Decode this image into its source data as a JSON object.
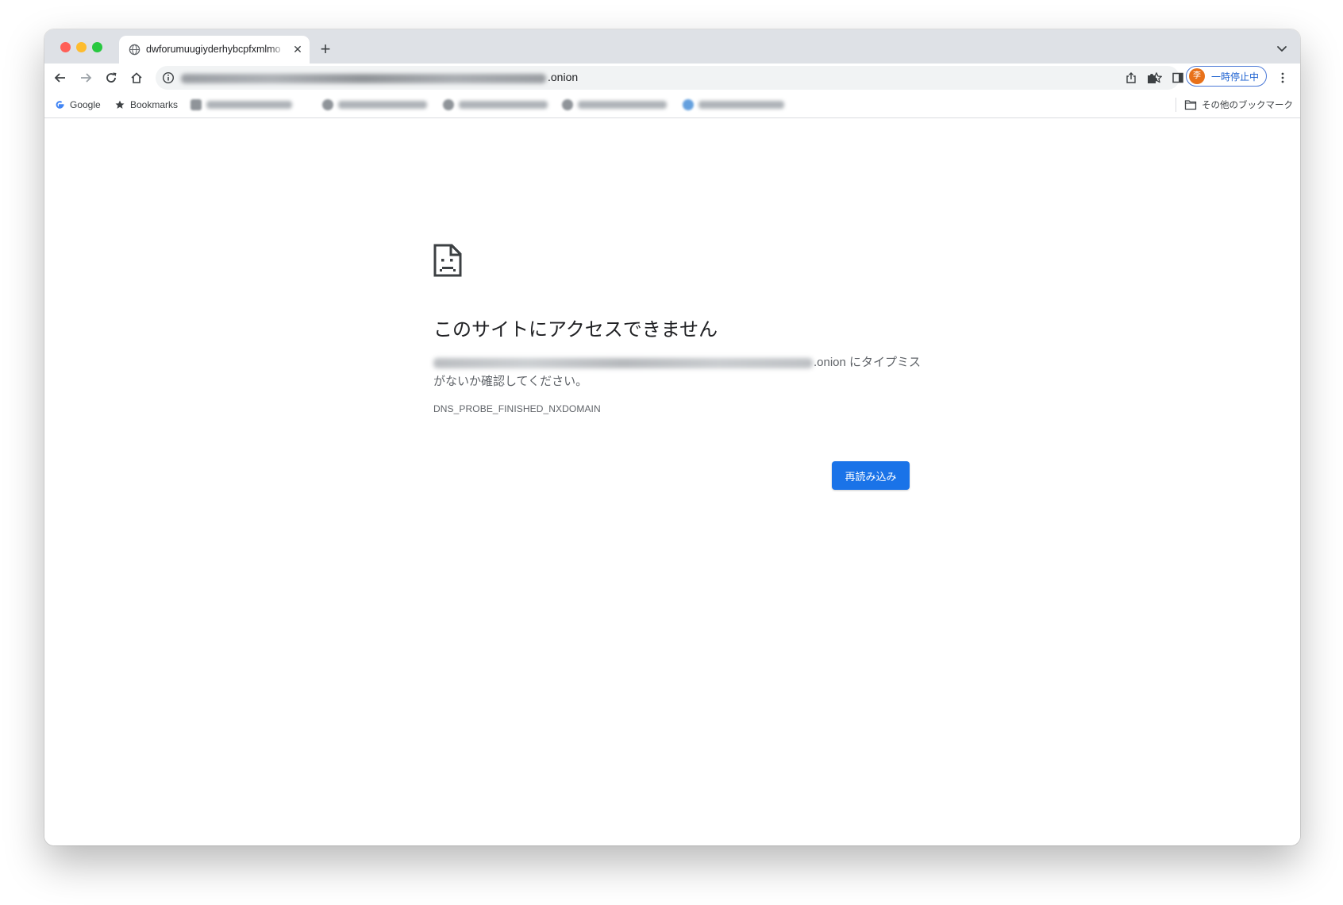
{
  "tab": {
    "title": "dwforumuugiyderhybcpfxmlmo",
    "close_glyph": "✕",
    "new_tab_glyph": "+"
  },
  "toolbar": {
    "url_tld": ".onion",
    "profile_initial": "李",
    "profile_status": "一時停止中"
  },
  "bookmarks": {
    "items": [
      {
        "label": "Google",
        "icon": "google-g-icon"
      },
      {
        "label": "Bookmarks",
        "icon": "star-icon"
      }
    ],
    "other_label": "その他のブックマーク"
  },
  "error": {
    "title": "このサイトにアクセスできません",
    "desc_suffix": ".onion にタイプミスがないか確認してください。",
    "code": "DNS_PROBE_FINISHED_NXDOMAIN",
    "reload_label": "再読み込み"
  },
  "colors": {
    "accent": "#1a73e8",
    "tabstrip": "#dee1e6",
    "avatar": "#e8711a"
  }
}
